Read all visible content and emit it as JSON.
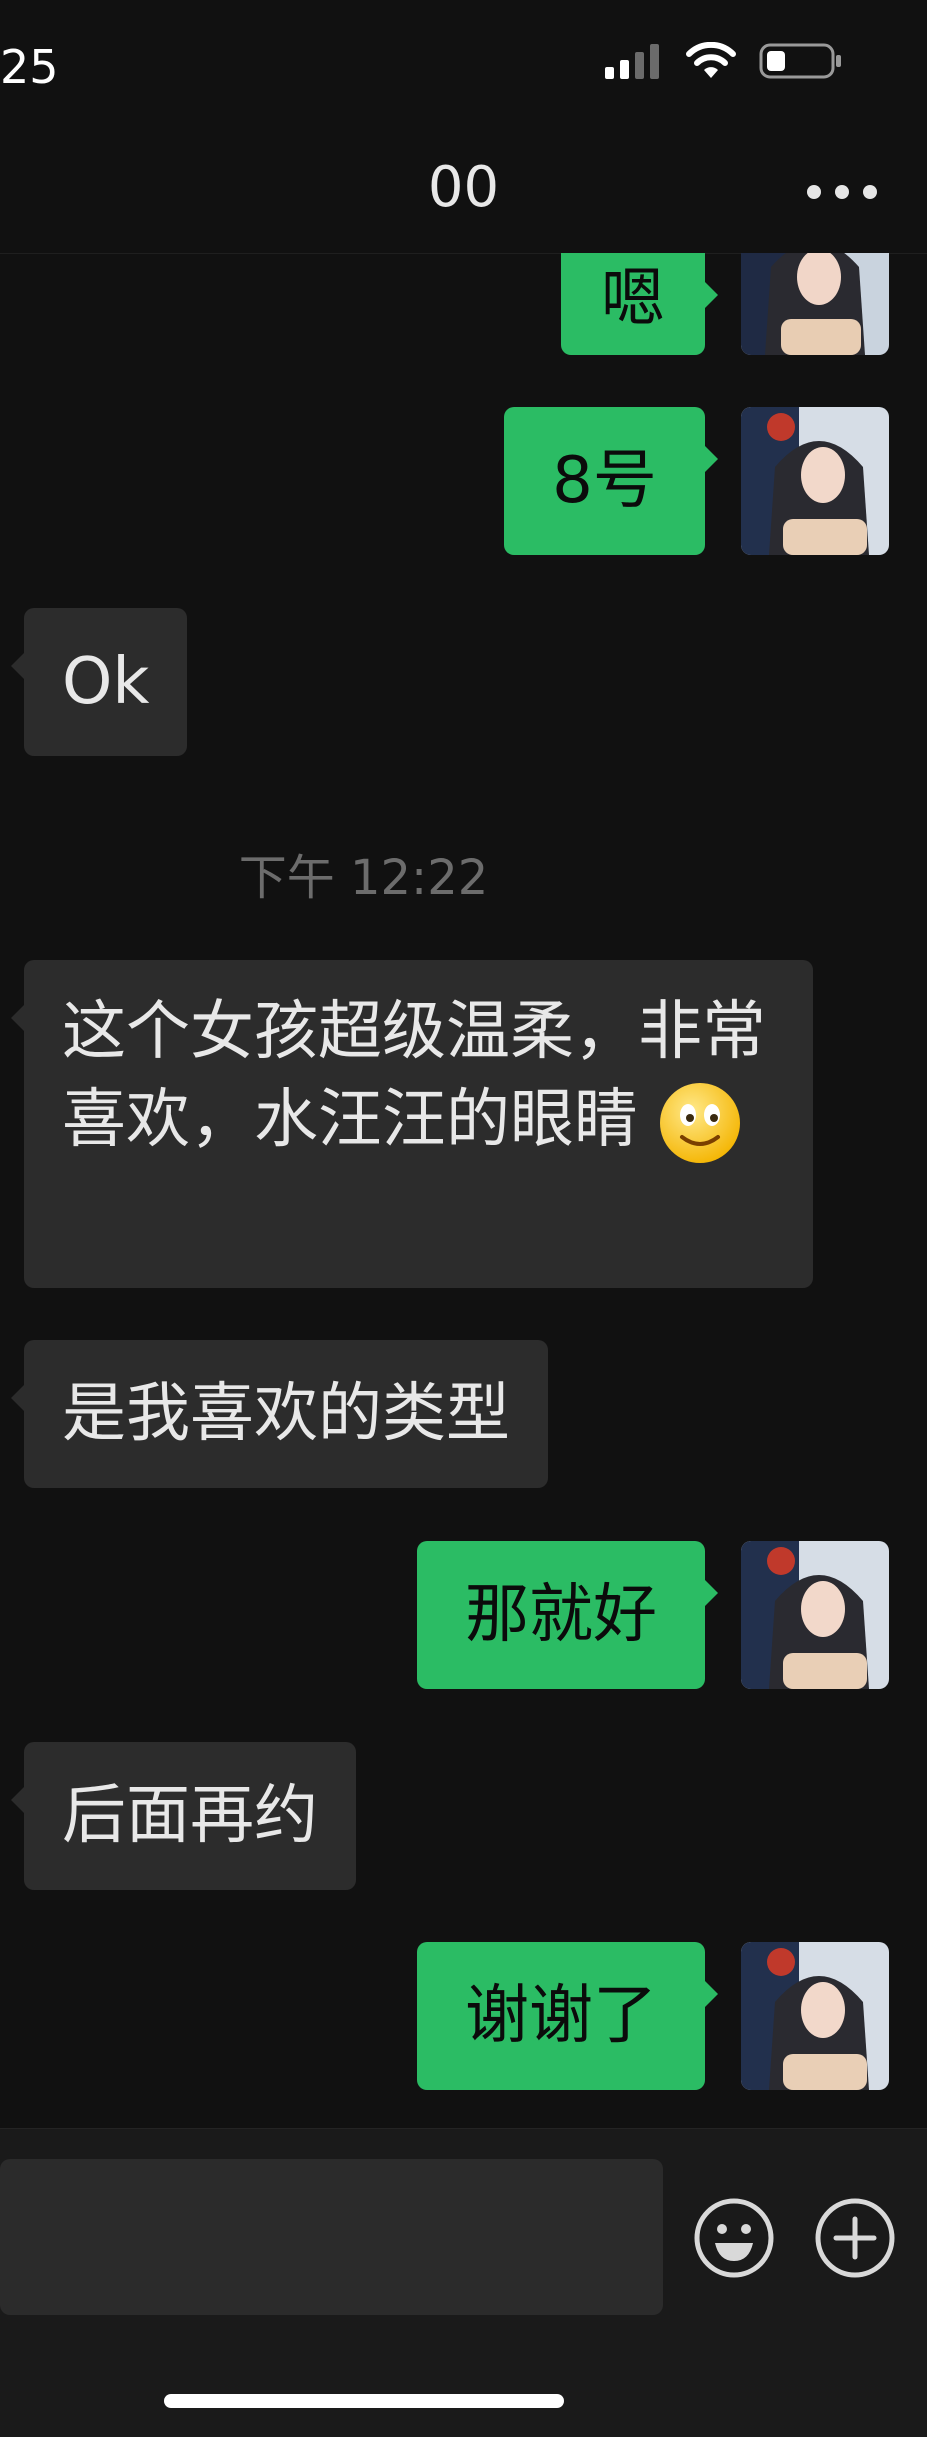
{
  "status_bar": {
    "time": "25"
  },
  "nav": {
    "title": "00"
  },
  "messages": [
    {
      "sender": "me",
      "text": "嗯"
    },
    {
      "sender": "me",
      "text": "8号"
    },
    {
      "sender": "them",
      "text": "Ok"
    },
    {
      "type": "timestamp",
      "text": "下午 12:22"
    },
    {
      "sender": "them",
      "text": "这个女孩超级温柔，非常喜欢，水汪汪的眼睛"
    },
    {
      "sender": "them",
      "text": "是我喜欢的类型"
    },
    {
      "sender": "me",
      "text": "那就好"
    },
    {
      "sender": "them",
      "text": "后面再约"
    },
    {
      "sender": "me",
      "text": "谢谢了"
    }
  ],
  "colors": {
    "background": "#111111",
    "my_bubble": "#2BBC64",
    "their_bubble": "#2C2C2C",
    "input_bar": "#1A1A1A"
  },
  "icons": {
    "emoji_button": "emoji-face-icon",
    "more_button": "plus-circle-icon",
    "inline_emoji": "slight-smile-emoji-icon"
  }
}
